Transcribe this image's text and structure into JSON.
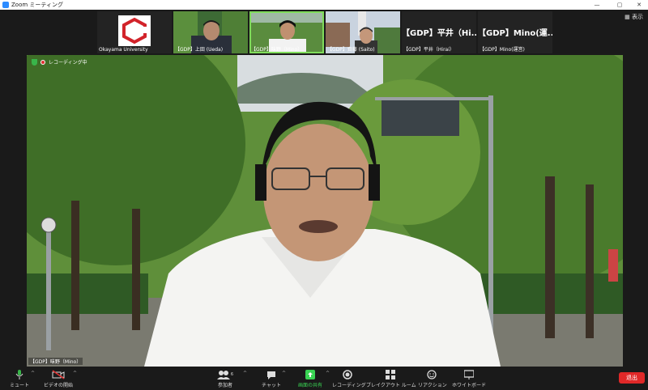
{
  "window": {
    "title": "Zoom ミーティング",
    "minimize": "—",
    "maximize": "▢",
    "close": "✕"
  },
  "view_button": "表示",
  "thumbnails": [
    {
      "name": "Okayama University",
      "kind": "logo"
    },
    {
      "name": "【GDP】上田 (Ueda)",
      "kind": "video"
    },
    {
      "name": "【GDP】味野（Mino）",
      "kind": "video",
      "active": true
    },
    {
      "name": "【GDP】齊藤 (Saito)",
      "kind": "video",
      "muted": true
    },
    {
      "name": "【GDP】平井（Hirai）",
      "kind": "text",
      "big": "【GDP】平井（Hi...",
      "muted": true
    },
    {
      "name": "【GDP】Mino(運営)",
      "kind": "text",
      "big": "【GDP】Mino(運...",
      "muted": true
    }
  ],
  "main": {
    "recording_label": "レコーディング中",
    "speaker": "【GDP】味野（Mino）"
  },
  "toolbar": {
    "mute": "ミュート",
    "video": "ビデオの開始",
    "participants": "参加者",
    "participants_count": "6",
    "chat": "チャット",
    "share": "画面の共有",
    "record": "レコーディング",
    "breakout": "ブレイクアウト ルーム",
    "reactions": "リアクション",
    "whiteboard": "ホワイトボード",
    "leave": "退出"
  },
  "colors": {
    "share_green": "#39d353",
    "leave_red": "#e02828",
    "mic_green": "#39b54a",
    "video_red": "#e03030"
  }
}
